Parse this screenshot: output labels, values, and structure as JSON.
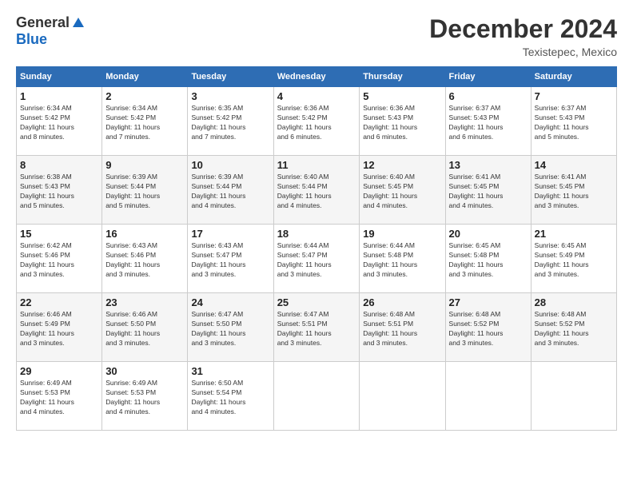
{
  "header": {
    "logo_general": "General",
    "logo_blue": "Blue",
    "month_title": "December 2024",
    "location": "Texistepec, Mexico"
  },
  "days_of_week": [
    "Sunday",
    "Monday",
    "Tuesday",
    "Wednesday",
    "Thursday",
    "Friday",
    "Saturday"
  ],
  "weeks": [
    [
      {
        "day": "1",
        "info": "Sunrise: 6:34 AM\nSunset: 5:42 PM\nDaylight: 11 hours\nand 8 minutes."
      },
      {
        "day": "2",
        "info": "Sunrise: 6:34 AM\nSunset: 5:42 PM\nDaylight: 11 hours\nand 7 minutes."
      },
      {
        "day": "3",
        "info": "Sunrise: 6:35 AM\nSunset: 5:42 PM\nDaylight: 11 hours\nand 7 minutes."
      },
      {
        "day": "4",
        "info": "Sunrise: 6:36 AM\nSunset: 5:42 PM\nDaylight: 11 hours\nand 6 minutes."
      },
      {
        "day": "5",
        "info": "Sunrise: 6:36 AM\nSunset: 5:43 PM\nDaylight: 11 hours\nand 6 minutes."
      },
      {
        "day": "6",
        "info": "Sunrise: 6:37 AM\nSunset: 5:43 PM\nDaylight: 11 hours\nand 6 minutes."
      },
      {
        "day": "7",
        "info": "Sunrise: 6:37 AM\nSunset: 5:43 PM\nDaylight: 11 hours\nand 5 minutes."
      }
    ],
    [
      {
        "day": "8",
        "info": "Sunrise: 6:38 AM\nSunset: 5:43 PM\nDaylight: 11 hours\nand 5 minutes."
      },
      {
        "day": "9",
        "info": "Sunrise: 6:39 AM\nSunset: 5:44 PM\nDaylight: 11 hours\nand 5 minutes."
      },
      {
        "day": "10",
        "info": "Sunrise: 6:39 AM\nSunset: 5:44 PM\nDaylight: 11 hours\nand 4 minutes."
      },
      {
        "day": "11",
        "info": "Sunrise: 6:40 AM\nSunset: 5:44 PM\nDaylight: 11 hours\nand 4 minutes."
      },
      {
        "day": "12",
        "info": "Sunrise: 6:40 AM\nSunset: 5:45 PM\nDaylight: 11 hours\nand 4 minutes."
      },
      {
        "day": "13",
        "info": "Sunrise: 6:41 AM\nSunset: 5:45 PM\nDaylight: 11 hours\nand 4 minutes."
      },
      {
        "day": "14",
        "info": "Sunrise: 6:41 AM\nSunset: 5:45 PM\nDaylight: 11 hours\nand 3 minutes."
      }
    ],
    [
      {
        "day": "15",
        "info": "Sunrise: 6:42 AM\nSunset: 5:46 PM\nDaylight: 11 hours\nand 3 minutes."
      },
      {
        "day": "16",
        "info": "Sunrise: 6:43 AM\nSunset: 5:46 PM\nDaylight: 11 hours\nand 3 minutes."
      },
      {
        "day": "17",
        "info": "Sunrise: 6:43 AM\nSunset: 5:47 PM\nDaylight: 11 hours\nand 3 minutes."
      },
      {
        "day": "18",
        "info": "Sunrise: 6:44 AM\nSunset: 5:47 PM\nDaylight: 11 hours\nand 3 minutes."
      },
      {
        "day": "19",
        "info": "Sunrise: 6:44 AM\nSunset: 5:48 PM\nDaylight: 11 hours\nand 3 minutes."
      },
      {
        "day": "20",
        "info": "Sunrise: 6:45 AM\nSunset: 5:48 PM\nDaylight: 11 hours\nand 3 minutes."
      },
      {
        "day": "21",
        "info": "Sunrise: 6:45 AM\nSunset: 5:49 PM\nDaylight: 11 hours\nand 3 minutes."
      }
    ],
    [
      {
        "day": "22",
        "info": "Sunrise: 6:46 AM\nSunset: 5:49 PM\nDaylight: 11 hours\nand 3 minutes."
      },
      {
        "day": "23",
        "info": "Sunrise: 6:46 AM\nSunset: 5:50 PM\nDaylight: 11 hours\nand 3 minutes."
      },
      {
        "day": "24",
        "info": "Sunrise: 6:47 AM\nSunset: 5:50 PM\nDaylight: 11 hours\nand 3 minutes."
      },
      {
        "day": "25",
        "info": "Sunrise: 6:47 AM\nSunset: 5:51 PM\nDaylight: 11 hours\nand 3 minutes."
      },
      {
        "day": "26",
        "info": "Sunrise: 6:48 AM\nSunset: 5:51 PM\nDaylight: 11 hours\nand 3 minutes."
      },
      {
        "day": "27",
        "info": "Sunrise: 6:48 AM\nSunset: 5:52 PM\nDaylight: 11 hours\nand 3 minutes."
      },
      {
        "day": "28",
        "info": "Sunrise: 6:48 AM\nSunset: 5:52 PM\nDaylight: 11 hours\nand 3 minutes."
      }
    ],
    [
      {
        "day": "29",
        "info": "Sunrise: 6:49 AM\nSunset: 5:53 PM\nDaylight: 11 hours\nand 4 minutes."
      },
      {
        "day": "30",
        "info": "Sunrise: 6:49 AM\nSunset: 5:53 PM\nDaylight: 11 hours\nand 4 minutes."
      },
      {
        "day": "31",
        "info": "Sunrise: 6:50 AM\nSunset: 5:54 PM\nDaylight: 11 hours\nand 4 minutes."
      },
      {
        "day": "",
        "info": ""
      },
      {
        "day": "",
        "info": ""
      },
      {
        "day": "",
        "info": ""
      },
      {
        "day": "",
        "info": ""
      }
    ]
  ]
}
